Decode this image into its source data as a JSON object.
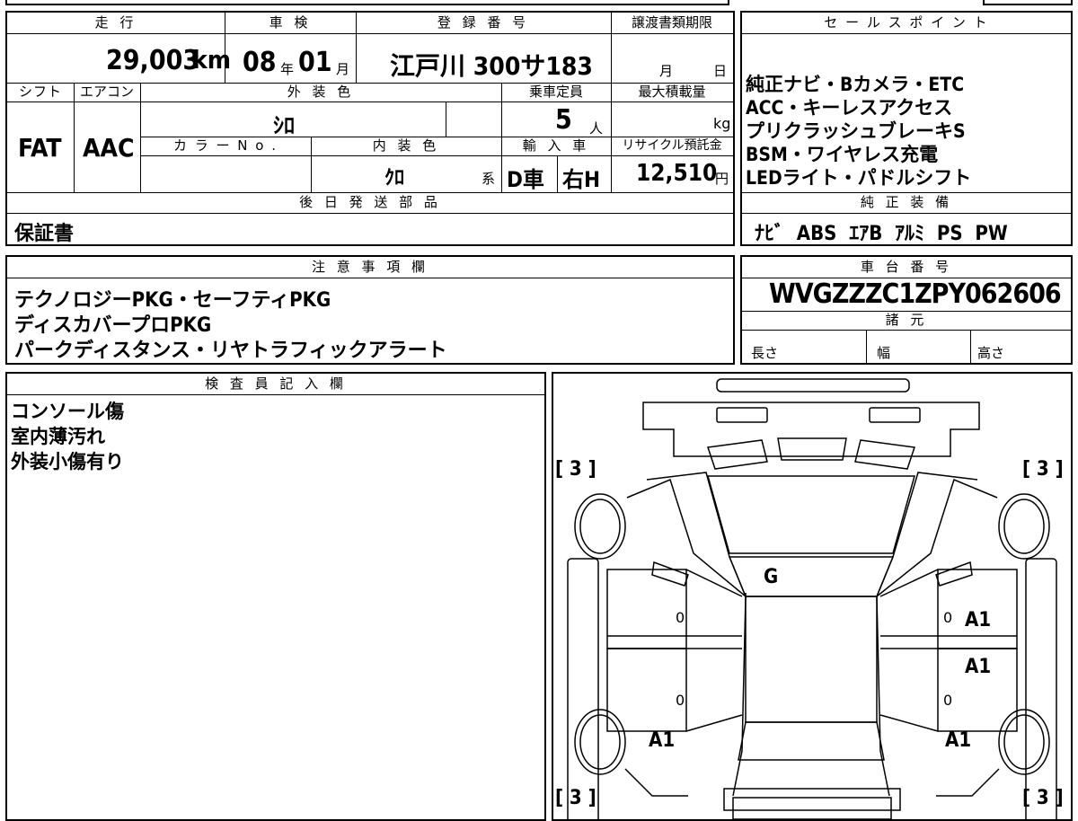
{
  "top_table": {
    "headers": {
      "mileage": "走 行",
      "inspection": "車 検",
      "registration": "登 録 番 号",
      "transfer_deadline": "譲渡書類期限",
      "shift": "シフト",
      "aircon": "エアコン",
      "exterior_color": "外 装 色",
      "capacity": "乗車定員",
      "max_load": "最大積載量",
      "color_no": "カ ラ ー N o .",
      "interior_color": "内 装 色",
      "import": "輸 入 車",
      "recycle": "リサイクル預託金",
      "later_parts": "後 日 発 送 部 品"
    },
    "mileage_value": "29,003",
    "mileage_unit": "km",
    "inspection_year": "08",
    "year_unit": "年",
    "inspection_month": "01",
    "month_unit": "月",
    "registration_value": "江戸川 300サ183",
    "deadline_month": "月",
    "deadline_day": "日",
    "shift_value": "FAT",
    "aircon_value": "AAC",
    "exterior_color_value": "ｼﾛ",
    "capacity_value": "5",
    "capacity_unit": "人",
    "max_load_unit": "kg",
    "interior_color_value": "ｸﾛ",
    "interior_color_suffix": "系",
    "import_type": "D車",
    "handle": "右H",
    "recycle_value": "12,510",
    "recycle_unit": "円",
    "later_parts_value": "保証書"
  },
  "sales_points": {
    "header": "セ ー ル ス ポ イ ン ト",
    "lines": [
      "純正ナビ・Bカメラ・ETC",
      "ACC・キーレスアクセス",
      "プリクラッシュブレーキS",
      "BSM・ワイヤレス充電",
      "LEDライト・パドルシフト"
    ]
  },
  "genuine_equipment": {
    "header": "純 正 装 備",
    "value": "ﾅﾋﾞ  ABS  ｴｱB  ｱﾙﾐ  PS  PW"
  },
  "notes": {
    "header": "注 意 事 項 欄",
    "lines": [
      "テクノロジーPKG・セーフティPKG",
      "ディスカバープロPKG",
      "パークディスタンス・リヤトラフィックアラート"
    ]
  },
  "chassis": {
    "header": "車 台 番 号",
    "value": "WVGZZZC1ZPY062606",
    "spec_header": "諸 元",
    "length_label": "長さ",
    "width_label": "幅",
    "height_label": "高さ"
  },
  "inspector": {
    "header": "検 査 員 記 入 欄",
    "lines": [
      "コンソール傷",
      "室内薄汚れ",
      "外装小傷有り"
    ]
  },
  "diagram": {
    "tire_tl": "[ 3 ]",
    "tire_tr": "[ 3 ]",
    "tire_bl": "[ 3 ]",
    "tire_br": "[ 3 ]",
    "windshield_mark": "G",
    "left_front_door_num": "0",
    "left_rear_door_num": "0",
    "right_front_door_num": "0",
    "right_rear_door_num": "0",
    "right_front_door_mark": "A1",
    "right_rear_door_mark": "A1",
    "left_rear_fender_mark": "A1",
    "right_rear_fender_mark": "A1"
  }
}
